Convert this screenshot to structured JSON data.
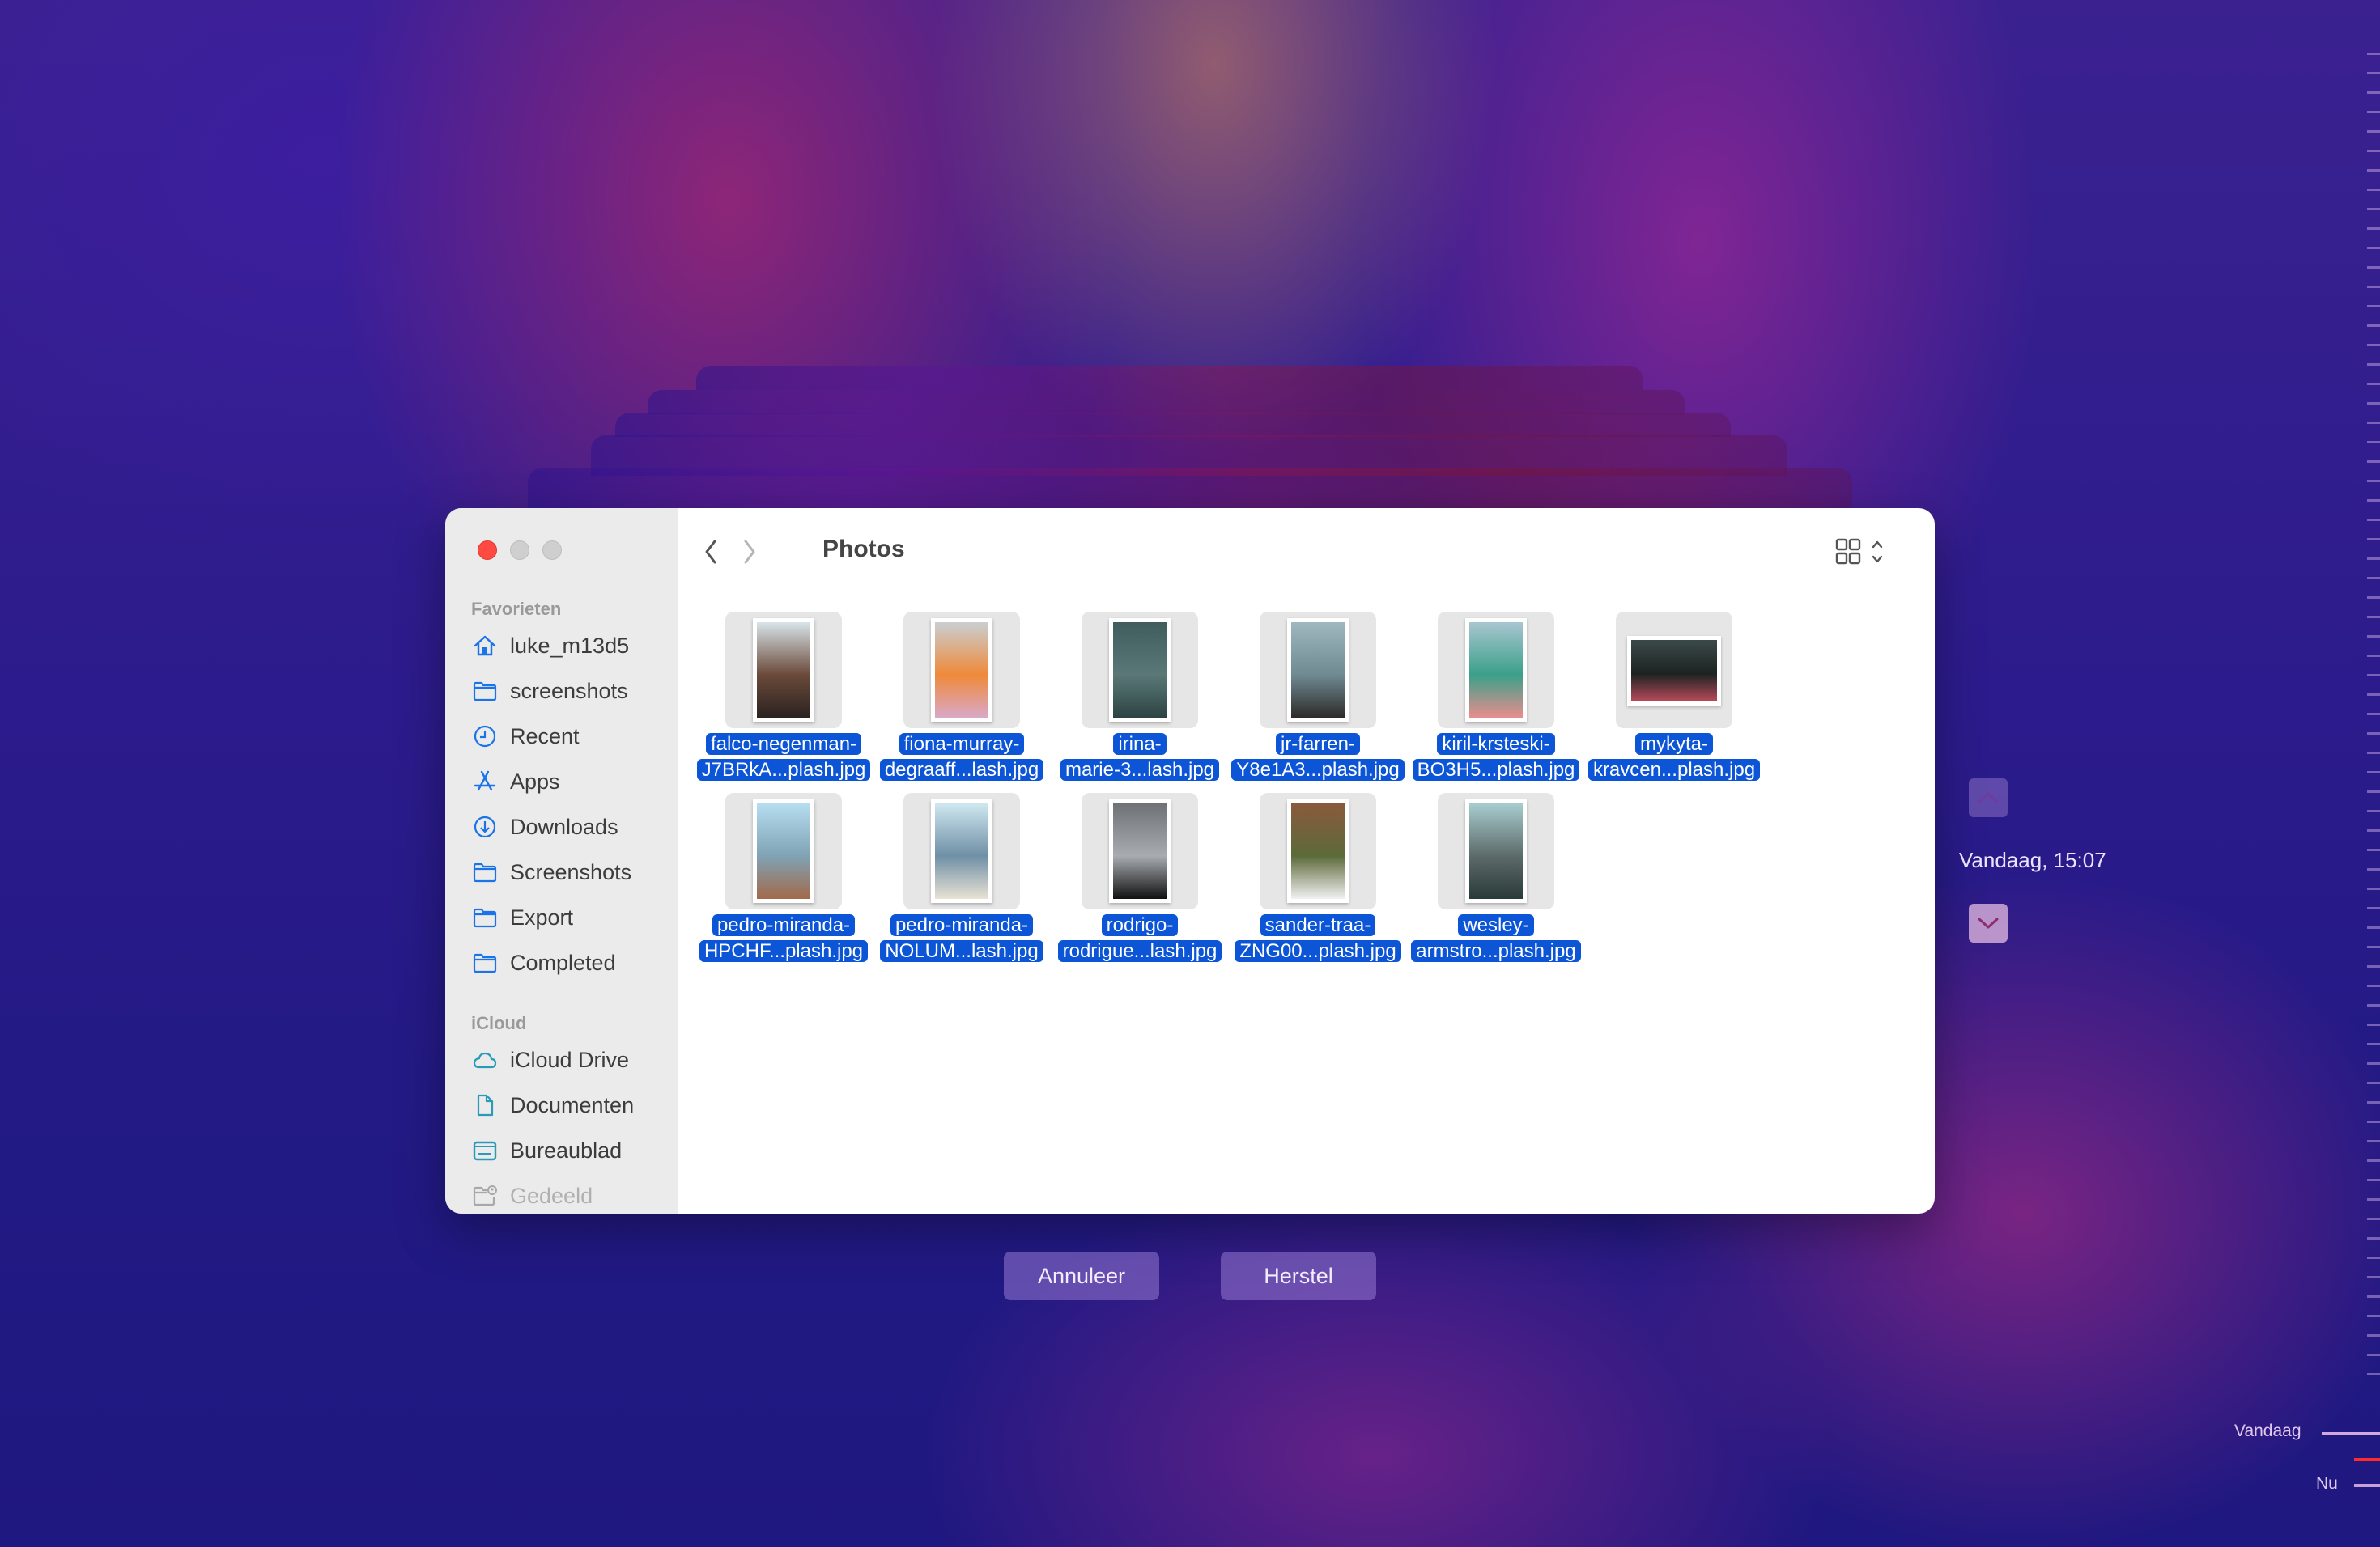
{
  "window": {
    "title": "Photos",
    "nav": {
      "back": "chevron-left-icon",
      "forward": "chevron-right-icon"
    },
    "toolbar_icons": [
      "icon-view-grid-icon",
      "chevron-updown-icon",
      "group-view-icon",
      "chevron-down-icon",
      "share-icon",
      "tag-icon",
      "more-actions-icon",
      "chevron-down-icon",
      "search-icon"
    ]
  },
  "sidebar": {
    "favorites_header": "Favorieten",
    "favorites": [
      {
        "label": "luke_m13d5",
        "icon": "home-icon"
      },
      {
        "label": "screenshots",
        "icon": "folder-icon"
      },
      {
        "label": "Recent",
        "icon": "clock-icon"
      },
      {
        "label": "Apps",
        "icon": "apps-icon"
      },
      {
        "label": "Downloads",
        "icon": "download-icon"
      },
      {
        "label": "Screenshots",
        "icon": "folder-icon"
      },
      {
        "label": "Export",
        "icon": "folder-icon"
      },
      {
        "label": "Completed",
        "icon": "folder-icon"
      }
    ],
    "icloud_header": "iCloud",
    "icloud": [
      {
        "label": "iCloud Drive",
        "icon": "cloud-icon"
      },
      {
        "label": "Documenten",
        "icon": "document-icon"
      },
      {
        "label": "Bureaublad",
        "icon": "desktop-icon"
      },
      {
        "label": "Gedeeld",
        "icon": "shared-folder-icon"
      }
    ]
  },
  "files": [
    {
      "line1": "falco-negenman-",
      "line2": "J7BRkA...plash.jpg",
      "orientation": "portrait",
      "colors": [
        "#d8e4ea",
        "#6b4a3a",
        "#2b2220"
      ]
    },
    {
      "line1": "fiona-murray-",
      "line2": "degraaff...lash.jpg",
      "orientation": "portrait",
      "colors": [
        "#c9cfd2",
        "#ef8a3a",
        "#d9a8c8"
      ]
    },
    {
      "line1": "irina-",
      "line2": "marie-3...lash.jpg",
      "orientation": "portrait",
      "colors": [
        "#3f5d5c",
        "#5a7877",
        "#2c4443"
      ]
    },
    {
      "line1": "jr-farren-",
      "line2": "Y8e1A3...plash.jpg",
      "orientation": "portrait",
      "colors": [
        "#9fb8bf",
        "#6f8a92",
        "#2d2b28"
      ]
    },
    {
      "line1": "kiril-krsteski-",
      "line2": "BO3H5...plash.jpg",
      "orientation": "portrait",
      "colors": [
        "#a9c6d0",
        "#3aa08a",
        "#e98d8d"
      ]
    },
    {
      "line1": "mykyta-",
      "line2": "kravcen...plash.jpg",
      "orientation": "landscape",
      "colors": [
        "#3b4a48",
        "#1c2322",
        "#b94a5a"
      ]
    },
    {
      "line1": "pedro-miranda-",
      "line2": "HPCHF...plash.jpg",
      "orientation": "portrait",
      "colors": [
        "#b6def0",
        "#7fa3b4",
        "#a2694a"
      ]
    },
    {
      "line1": "pedro-miranda-",
      "line2": "NOLUM...lash.jpg",
      "orientation": "portrait",
      "colors": [
        "#cfe8f0",
        "#6f8fa6",
        "#e9e2d4"
      ]
    },
    {
      "line1": "rodrigo-",
      "line2": "rodrigue...lash.jpg",
      "orientation": "portrait",
      "colors": [
        "#6e7276",
        "#a8acb0",
        "#111112"
      ]
    },
    {
      "line1": "sander-traa-",
      "line2": "ZNG00...plash.jpg",
      "orientation": "portrait",
      "colors": [
        "#8a5a3c",
        "#5c6a3a",
        "#f1f1f1"
      ]
    },
    {
      "line1": "wesley-",
      "line2": "armstro...plash.jpg",
      "orientation": "portrait",
      "colors": [
        "#a8cdd0",
        "#5c6b69",
        "#2a3a38"
      ]
    }
  ],
  "actions": {
    "cancel": "Annuleer",
    "restore": "Herstel"
  },
  "time_machine": {
    "current": "Vandaag, 15:07",
    "timeline_today": "Vandaag",
    "timeline_now": "Nu",
    "accent_now": "#ff2a2a"
  },
  "colors": {
    "selection": "#0b55d6",
    "sidebar_icon": "#1a73e8",
    "icloud_icon": "#2a9ab8"
  }
}
